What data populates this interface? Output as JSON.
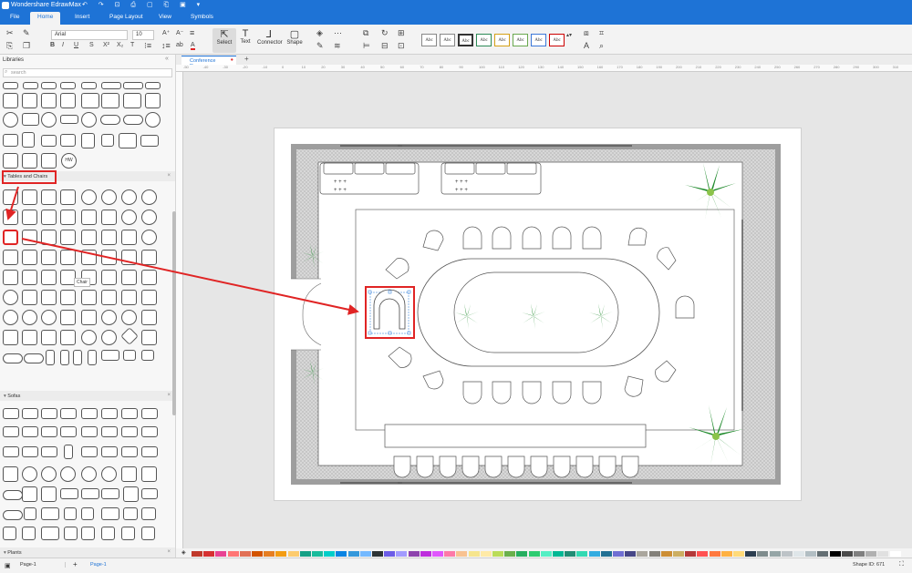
{
  "app": {
    "title": "Wondershare EdrawMax"
  },
  "menu": {
    "items": [
      "File",
      "Home",
      "Insert",
      "Page Layout",
      "View",
      "Symbols"
    ],
    "active": "Home"
  },
  "ribbon": {
    "font_name": "Arial",
    "font_size": "10",
    "tools": [
      "Select",
      "Text",
      "Connector",
      "Shape"
    ],
    "style_sample": "Abc"
  },
  "sidebar": {
    "title": "Libraries",
    "search_placeholder": "search",
    "hw_label": "HW",
    "sections": [
      "Tables and Chairs",
      "Sofas",
      "Plants"
    ],
    "tooltip": "Chair"
  },
  "document": {
    "tab_label": "Conference Room",
    "ruler_ticks": [
      "-50",
      "-40",
      "-30",
      "-20",
      "-10",
      "0",
      "10",
      "20",
      "30",
      "40",
      "50",
      "60",
      "70",
      "80",
      "90",
      "100",
      "110",
      "120",
      "130",
      "140",
      "150",
      "160",
      "170",
      "180",
      "190",
      "200",
      "210",
      "220",
      "230",
      "240",
      "250",
      "260",
      "270",
      "280",
      "290",
      "300",
      "310"
    ]
  },
  "status": {
    "page_selector": "Page-1",
    "page_tab": "Page-1",
    "shape_id": "Shape ID: 671"
  },
  "colors": {
    "accent": "#1e73d6",
    "highlight": "#e02424",
    "palette": [
      "#c0392b",
      "#d63031",
      "#e84393",
      "#ff7675",
      "#e17055",
      "#d35400",
      "#e67e22",
      "#f39c12",
      "#fdcb6e",
      "#16a085",
      "#1abc9c",
      "#00cec9",
      "#0984e3",
      "#3498db",
      "#74b9ff",
      "#2d3436",
      "#6c5ce7",
      "#a29bfe",
      "#8e44ad",
      "#be2edd",
      "#e056fd",
      "#fd79a8",
      "#f8c291",
      "#f6e58d",
      "#ffeaa7",
      "#badc58",
      "#6ab04c",
      "#27ae60",
      "#2ecc71",
      "#55efc4",
      "#00b894",
      "#218c74",
      "#33d9b2",
      "#34ace0",
      "#227093",
      "#706fd3",
      "#474787",
      "#aaa69d",
      "#84817a",
      "#cc8e35",
      "#ccae62",
      "#b33939",
      "#ff5252",
      "#ff793f",
      "#ffb142",
      "#ffda79",
      "#2c3e50",
      "#7f8c8d",
      "#95a5a6",
      "#bdc3c7",
      "#dfe6e9",
      "#b2bec3",
      "#636e72",
      "#000000",
      "#4a4a4a",
      "#808080",
      "#b0b0b0",
      "#e0e0e0",
      "#ffffff"
    ]
  }
}
